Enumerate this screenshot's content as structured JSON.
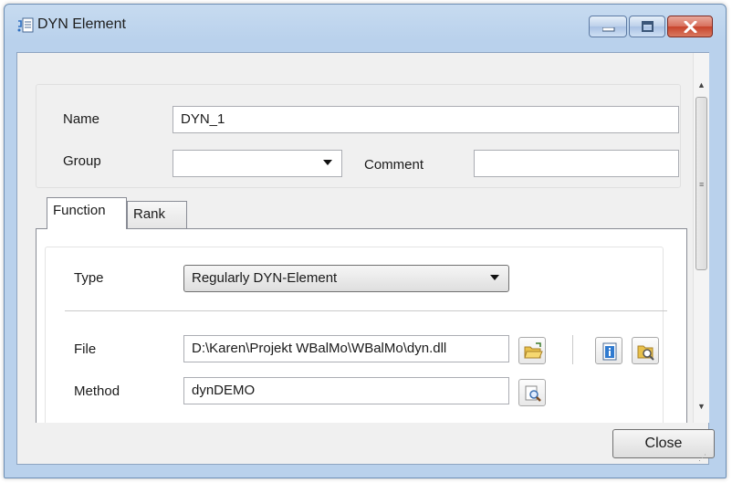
{
  "window": {
    "title": "DYN Element",
    "title_icon": "dyn-element-icon"
  },
  "header_fields": {
    "name_label": "Name",
    "name_value": "DYN_1",
    "group_label": "Group",
    "group_value": "",
    "comment_label": "Comment",
    "comment_value": ""
  },
  "tabs": [
    {
      "label": "Function",
      "active": true
    },
    {
      "label": "Rank",
      "active": false
    }
  ],
  "function_tab": {
    "type_label": "Type",
    "type_value": "Regularly DYN-Element",
    "file_label": "File",
    "file_value": "D:\\Karen\\Projekt WBalMo\\WBalMo\\dyn.dll",
    "method_label": "Method",
    "method_value": "dynDEMO",
    "icons": [
      "open-folder-icon",
      "info-icon",
      "folder-search-icon",
      "search-icon"
    ]
  },
  "footer": {
    "close_label": "Close"
  },
  "colors": {
    "title_bar": "#b9d1ec",
    "close_button": "#c7442c",
    "client_background": "#f0f0f0"
  }
}
